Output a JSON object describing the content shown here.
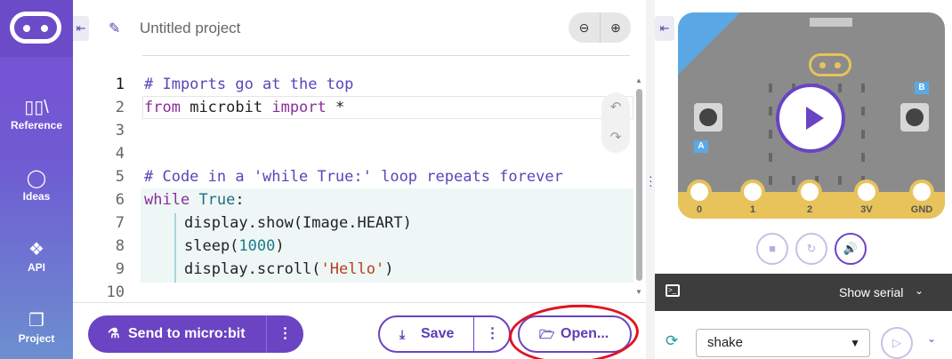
{
  "nav": {
    "items": [
      {
        "label": "Reference",
        "icon": "books-icon"
      },
      {
        "label": "Ideas",
        "icon": "lightbulb-icon"
      },
      {
        "label": "API",
        "icon": "python-icon"
      },
      {
        "label": "Project",
        "icon": "files-icon"
      }
    ]
  },
  "editor": {
    "project_name": "Untitled project",
    "zoom_out": "−",
    "zoom_in": "+",
    "line_numbers": [
      "1",
      "2",
      "3",
      "4",
      "5",
      "6",
      "7",
      "8",
      "9",
      "10"
    ],
    "code": {
      "l1_comment": "# Imports go at the top",
      "l2_from": "from",
      "l2_module": "microbit",
      "l2_import": "import",
      "l2_star": "*",
      "l5_comment": "# Code in a 'while True:' loop repeats forever",
      "l6_while": "while",
      "l6_true": "True",
      "l6_colon": ":",
      "l7": "display.show(Image.HEART)",
      "l8_fn": "sleep(",
      "l8_num": "1000",
      "l8_end": ")",
      "l9_fn": "display.scroll(",
      "l9_str": "'Hello'",
      "l9_end": ")"
    }
  },
  "toolbar": {
    "send_label": "Send to micro:bit",
    "more_label": "⋮",
    "save_label": "Save",
    "open_label": "Open..."
  },
  "simulator": {
    "pins": [
      "0",
      "1",
      "2",
      "3V",
      "GND"
    ],
    "button_a": "A",
    "button_b": "B",
    "serial_label": "Show serial",
    "gesture_value": "shake"
  },
  "colors": {
    "accent": "#6a44c2",
    "annotation": "#e0141e"
  }
}
